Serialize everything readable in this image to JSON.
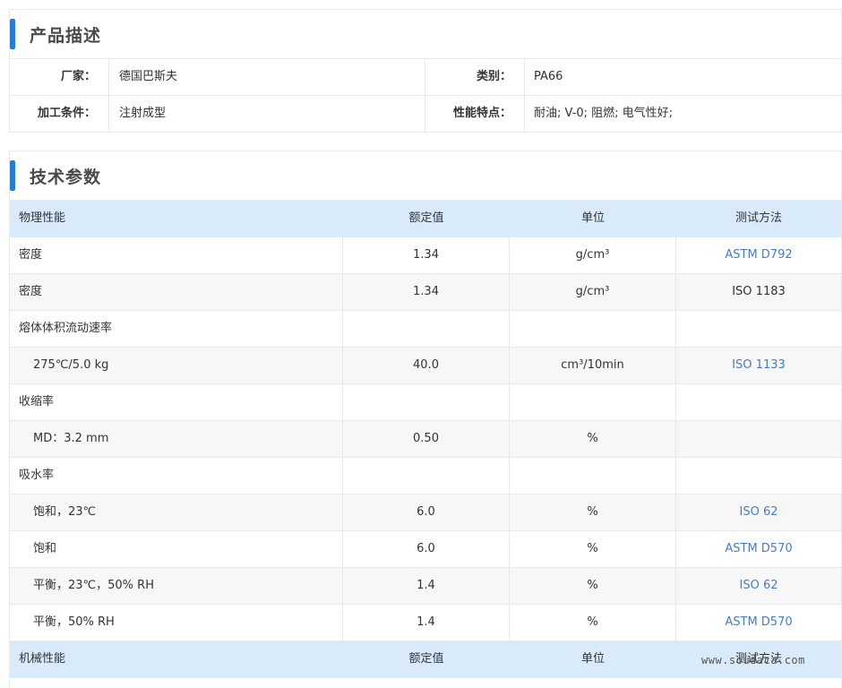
{
  "product_section": {
    "title": "产品描述",
    "rows": [
      {
        "label1": "厂家：",
        "value1": "德国巴斯夫",
        "label2": "类别：",
        "value2": "PA66"
      },
      {
        "label1": "加工条件：",
        "value1": "注射成型",
        "label2": "性能特点：",
        "value2": "耐油; V-0; 阻燃; 电气性好;"
      }
    ]
  },
  "tech_section": {
    "title": "技术参数",
    "header": {
      "name": "物理性能",
      "value": "额定值",
      "unit": "单位",
      "method": "测试方法"
    },
    "rows": [
      {
        "name": "密度",
        "value": "1.34",
        "unit": "g/cm³",
        "method": "ASTM D792"
      },
      {
        "name": "密度",
        "value": "1.34",
        "unit": "g/cm³",
        "method": "ISO 1183"
      },
      {
        "name": "熔体体积流动速率",
        "value": "",
        "unit": "",
        "method": ""
      },
      {
        "name": "275℃/5.0 kg",
        "value": "40.0",
        "unit": "cm³/10min",
        "method": "ISO 1133"
      },
      {
        "name": "收缩率",
        "value": "",
        "unit": "",
        "method": ""
      },
      {
        "name": "MD：3.2 mm",
        "value": "0.50",
        "unit": "%",
        "method": ""
      },
      {
        "name": "吸水率",
        "value": "",
        "unit": "",
        "method": ""
      },
      {
        "name": "饱和，23℃",
        "value": "6.0",
        "unit": "%",
        "method": "ISO 62"
      },
      {
        "name": "饱和",
        "value": "6.0",
        "unit": "%",
        "method": "ASTM D570"
      },
      {
        "name": "平衡，23℃，50% RH",
        "value": "1.4",
        "unit": "%",
        "method": "ISO 62"
      },
      {
        "name": "平衡，50% RH",
        "value": "1.4",
        "unit": "%",
        "method": "ASTM D570"
      }
    ],
    "header2": {
      "name": "机械性能",
      "value": "额定值",
      "unit": "单位",
      "method": "测试方法"
    }
  },
  "watermark": "www.soudaca.com",
  "colors": {
    "accent": "#1e7fe0",
    "header_bg": "#d9ebfb",
    "link": "#4a7db8"
  }
}
